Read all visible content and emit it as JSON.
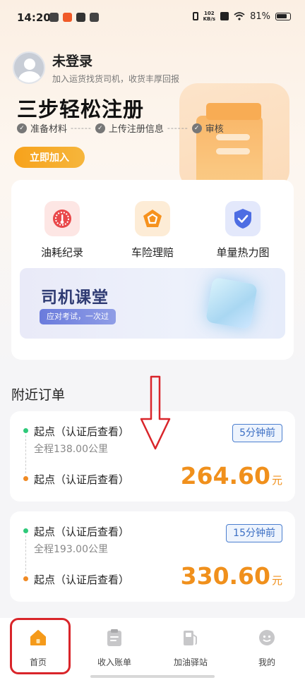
{
  "status_bar": {
    "time": "14:20",
    "speed_value": "102",
    "speed_unit": "KB/s",
    "battery": "81%"
  },
  "profile": {
    "name": "未登录",
    "subtitle": "加入运货找货司机，收货丰厚回报"
  },
  "hero": {
    "title": "三步轻松注册",
    "steps": [
      "准备材料",
      "上传注册信息",
      "审核"
    ],
    "step_dots": "------",
    "join_label": "立即加入"
  },
  "features": {
    "items": [
      {
        "label": "油耗纪录",
        "icon": "fuel-gauge-icon"
      },
      {
        "label": "车险理赔",
        "icon": "pentagon-shield-icon"
      },
      {
        "label": "单量热力图",
        "icon": "check-shield-icon"
      }
    ],
    "banner": {
      "title": "司机课堂",
      "tag": "应对考试，一次过"
    }
  },
  "nearby": {
    "section_title": "附近订单",
    "orders": [
      {
        "start": "起点（认证后查看）",
        "distance": "全程138.00公里",
        "end": "起点（认证后查看）",
        "time_ago": "5分钟前",
        "price": "264.60",
        "unit": "元"
      },
      {
        "start": "起点（认证后查看）",
        "distance": "全程193.00公里",
        "end": "起点（认证后查看）",
        "time_ago": "15分钟前",
        "price": "330.60",
        "unit": "元"
      }
    ]
  },
  "tabbar": {
    "tabs": [
      {
        "label": "首页",
        "icon": "home-icon",
        "active": true
      },
      {
        "label": "收入账单",
        "icon": "clipboard-icon",
        "active": false
      },
      {
        "label": "加油驿站",
        "icon": "gas-pump-icon",
        "active": false
      },
      {
        "label": "我的",
        "icon": "profile-face-icon",
        "active": false
      }
    ]
  },
  "colors": {
    "accent": "#f7a21b",
    "price": "#f0901c",
    "badge": "#3c6fc4",
    "annotation": "#d9252a"
  }
}
